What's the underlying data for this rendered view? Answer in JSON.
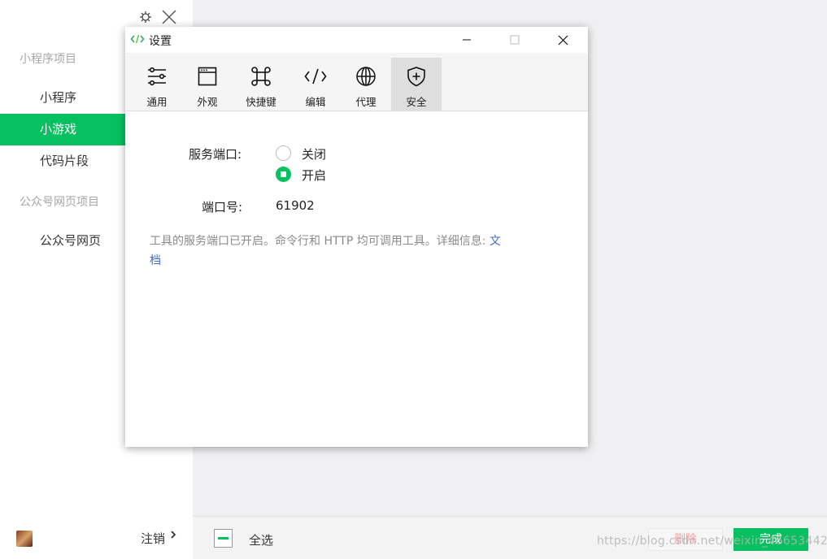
{
  "sidebar": {
    "sections": [
      {
        "title": "小程序项目",
        "items": [
          "小程序",
          "小游戏",
          "代码片段"
        ]
      },
      {
        "title": "公众号网页项目",
        "items": [
          "公众号网页"
        ]
      }
    ],
    "active_item": "小游戏",
    "footer": {
      "logout_label": "注销"
    }
  },
  "bottom_bar": {
    "select_all_label": "全选",
    "delete_label": "删除",
    "done_label": "完成",
    "watermark": "https://blog.csdn.net/weixin_46653442"
  },
  "dialog": {
    "title": "设置",
    "tabs": [
      {
        "label": "通用",
        "icon": "sliders-icon"
      },
      {
        "label": "外观",
        "icon": "window-icon"
      },
      {
        "label": "快捷键",
        "icon": "command-key-icon"
      },
      {
        "label": "编辑",
        "icon": "code-icon"
      },
      {
        "label": "代理",
        "icon": "globe-icon"
      },
      {
        "label": "安全",
        "icon": "shield-plus-icon"
      }
    ],
    "active_tab": "安全",
    "service_port": {
      "label": "服务端口:",
      "options": [
        "关闭",
        "开启"
      ],
      "selected": "开启"
    },
    "port_number": {
      "label": "端口号:",
      "value": "61902"
    },
    "description": {
      "text": "工具的服务端口已开启。命令行和 HTTP 均可调用工具。详细信息: ",
      "link_part1": "文",
      "link_part2": "档"
    }
  },
  "colors": {
    "accent": "#07c160",
    "link": "#3d6bd6"
  }
}
